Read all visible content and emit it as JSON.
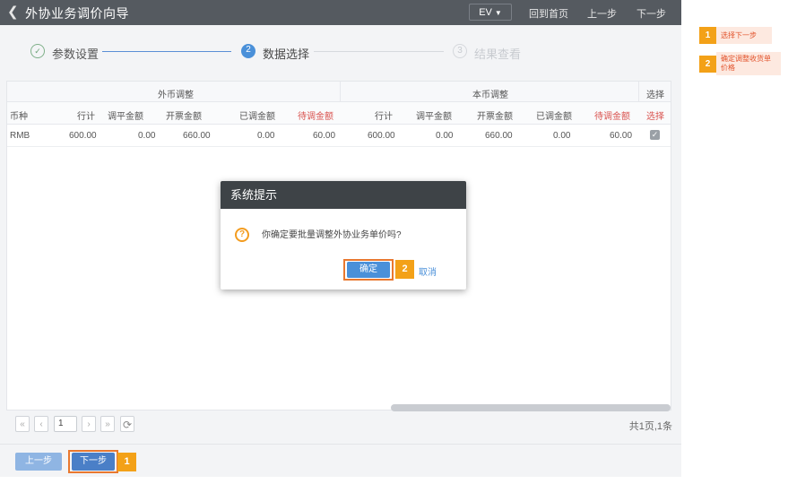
{
  "header": {
    "back_icon": "chevron-left-icon",
    "title": "外协业务调价向导",
    "ev_label": "EV",
    "home_link": "回到首页",
    "prev_link": "上一步",
    "next_link": "下一步"
  },
  "steps": [
    {
      "label": "参数设置",
      "state": "done"
    },
    {
      "number": "2",
      "label": "数据选择",
      "state": "active"
    },
    {
      "number": "3",
      "label": "结果查看",
      "state": "pending"
    }
  ],
  "table": {
    "group_headers": {
      "foreign": "外币调整",
      "local": "本币调整",
      "select": "选择"
    },
    "columns": [
      "币种",
      "行计",
      "调平金额",
      "开票金额",
      "已调金额",
      "待调金额",
      "行计",
      "调平金额",
      "开票金额",
      "已调金额",
      "待调金额",
      "选择"
    ],
    "rows": [
      [
        "RMB",
        "600.00",
        "0.00",
        "660.00",
        "0.00",
        "60.00",
        "600.00",
        "0.00",
        "660.00",
        "0.00",
        "60.00"
      ]
    ]
  },
  "pager": {
    "first": "«",
    "prev": "‹",
    "page": "1",
    "next": "›",
    "last": "»",
    "refresh_icon": "refresh-icon",
    "info": "共1页,1条"
  },
  "footer": {
    "prev_button": "上一步",
    "next_button": "下一步",
    "next_badge": "1"
  },
  "dialog": {
    "title": "系统提示",
    "icon": "question-icon",
    "message": "你确定要批量调整外协业务单价吗?",
    "ok_button": "确定",
    "ok_badge": "2",
    "cancel_button": "取消"
  },
  "annotations": [
    {
      "number": "1",
      "text": "选择下一步"
    },
    {
      "number": "2",
      "text": "确定调整收货单价格"
    }
  ],
  "colors": {
    "topbar": "#555a60",
    "accent": "#4a90d9",
    "badge": "#f3a118",
    "highlight": "#e9782f",
    "warning_text": "#d9534f"
  }
}
